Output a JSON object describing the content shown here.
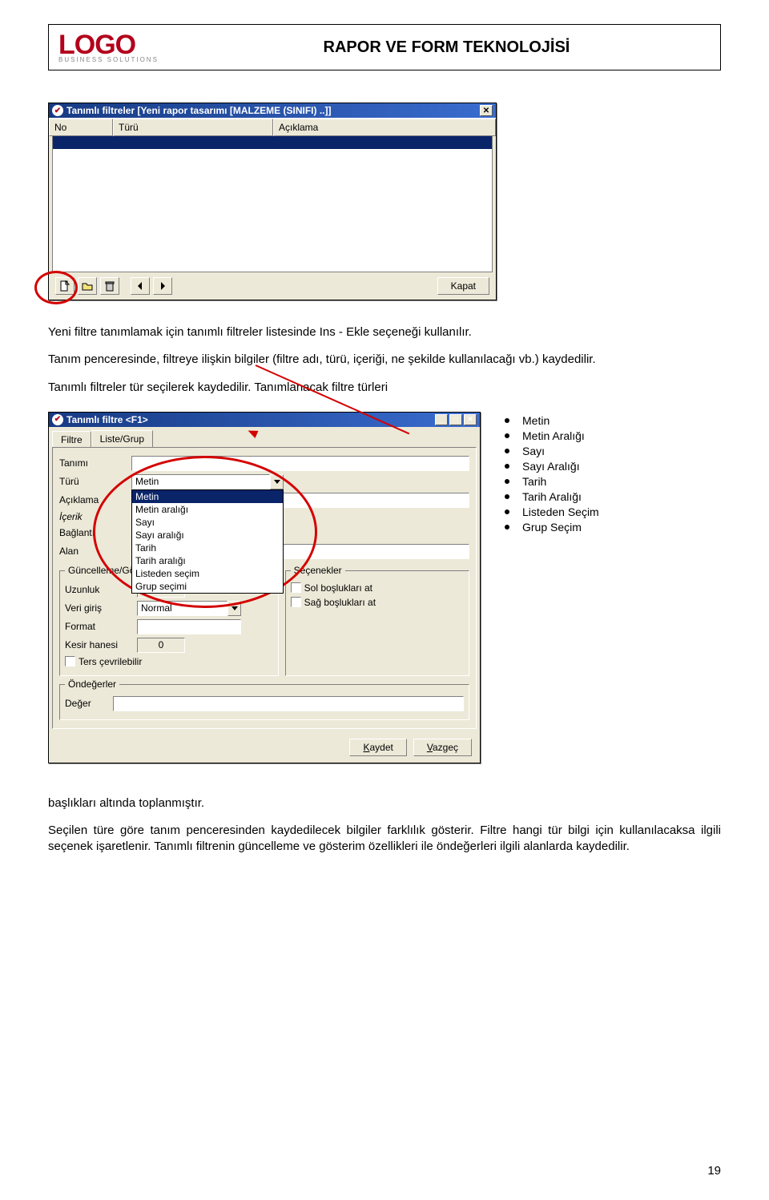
{
  "header": {
    "logo_main": "LOGO",
    "logo_sub": "BUSINESS SOLUTIONS",
    "page_title": "RAPOR VE FORM TEKNOLOJİSİ"
  },
  "window1": {
    "title": "Tanımlı filtreler [Yeni rapor tasarımı [MALZEME (SINIFI) ..]]",
    "col_no": "No",
    "col_turu": "Türü",
    "col_aciklama": "Açıklama",
    "btn_kapat": "Kapat"
  },
  "para1": "Yeni filtre tanımlamak için tanımlı filtreler listesinde Ins - Ekle seçeneği kullanılır.",
  "para2": "Tanım penceresinde, filtreye ilişkin bilgiler (filtre adı, türü, içeriği, ne şekilde kullanılacağı  vb.) kaydedilir.",
  "para3": "Tanımlı filtreler tür seçilerek kaydedilir. Tanımlanacak filtre türleri",
  "window2": {
    "title": "Tanımlı filtre <F1>",
    "tab_filtre": "Filtre",
    "tab_liste": "Liste/Grup",
    "lbl_tanimi": "Tanımı",
    "lbl_turu": "Türü",
    "turu_value": "Metin",
    "lbl_aciklama": "Açıklama",
    "lbl_icerik": "İçerik",
    "lbl_baglanti": "Bağlantı",
    "lbl_alan": "Alan",
    "grp_guncelleme": "Güncelleme/Gös",
    "lbl_uzunluk": "Uzunluk",
    "lbl_verigiris": "Veri giriş",
    "verigiris_value": "Normal",
    "lbl_format": "Format",
    "lbl_kesir": "Kesir hanesi",
    "kesir_value": "0",
    "cb_ters": "Ters çevrilebilir",
    "grp_secenekler": "Seçenekler",
    "cb_sol": "Sol boşlukları at",
    "cb_sag": "Sağ boşlukları at",
    "grp_ondeger": "Öndeğerler",
    "lbl_deger": "Değer",
    "btn_kaydet": "Kaydet",
    "btn_vazgec": "Vazgeç",
    "dropdown": [
      "Metin",
      "Metin aralığı",
      "Sayı",
      "Sayı aralığı",
      "Tarih",
      "Tarih aralığı",
      "Listeden seçim",
      "Grup seçimi"
    ]
  },
  "types": [
    "Metin",
    "Metin Aralığı",
    "Sayı",
    "Sayı Aralığı",
    "Tarih",
    "Tarih Aralığı",
    "Listeden Seçim",
    "Grup Seçim"
  ],
  "para4": "başlıkları altında toplanmıştır.",
  "para5": "Seçilen türe göre tanım penceresinden kaydedilecek bilgiler farklılık gösterir. Filtre hangi tür bilgi için kullanılacaksa ilgili seçenek işaretlenir. Tanımlı filtrenin güncelleme ve gösterim özellikleri ile öndeğerleri ilgili alanlarda kaydedilir.",
  "page_number": "19"
}
